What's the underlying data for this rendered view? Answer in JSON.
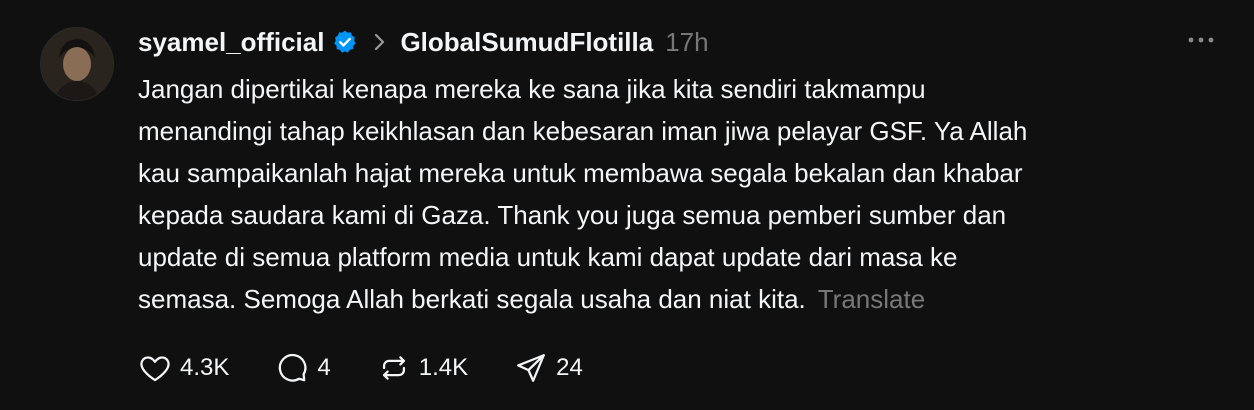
{
  "post": {
    "author": "syamel_official",
    "verified": true,
    "community": "GlobalSumudFlotilla",
    "time": "17h",
    "text_lines": [
      "Jangan dipertikai kenapa mereka ke sana jika kita sendiri takmampu",
      "menandingi tahap keikhlasan dan kebesaran iman jiwa pelayar GSF. Ya Allah",
      "kau sampaikanlah hajat mereka untuk membawa segala bekalan dan khabar",
      "kepada saudara kami di Gaza. Thank you juga semua pemberi sumber dan",
      "update di semua platform media untuk kami dapat update dari masa ke",
      "semasa. Semoga Allah berkati segala usaha dan niat kita."
    ],
    "translate_label": "Translate"
  },
  "actions": {
    "likes": "4.3K",
    "replies": "4",
    "reposts": "1.4K",
    "shares": "24"
  },
  "colors": {
    "background": "#101010",
    "text": "#f3f5f7",
    "muted": "#777777",
    "verified": "#0095f6"
  },
  "icons": {
    "verified": "verified-badge-icon",
    "chevron": "chevron-right-icon",
    "more": "more-options-icon",
    "like": "heart-icon",
    "reply": "comment-icon",
    "repost": "repost-icon",
    "share": "share-icon"
  }
}
